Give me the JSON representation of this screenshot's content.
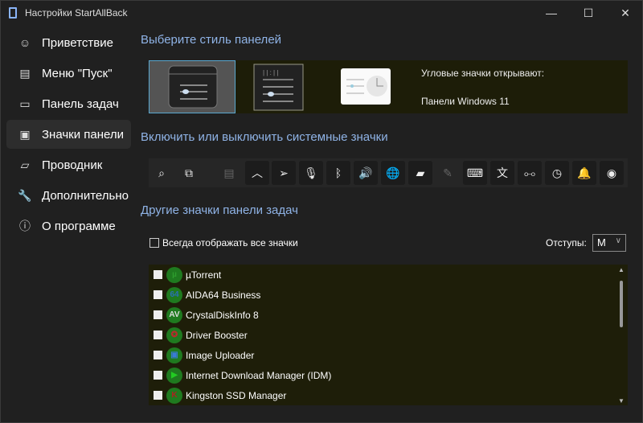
{
  "window": {
    "title": "Настройки StartAllBack",
    "minimize": "—",
    "maximize": "☐",
    "close": "✕"
  },
  "sidebar": {
    "items": [
      {
        "label": "Приветствие",
        "icon": "smiley-icon",
        "glyph": "☺"
      },
      {
        "label": "Меню \"Пуск\"",
        "icon": "start-menu-icon",
        "glyph": "▤"
      },
      {
        "label": "Панель задач",
        "icon": "taskbar-icon",
        "glyph": "▭"
      },
      {
        "label": "Значки панели",
        "icon": "tray-icons-icon",
        "glyph": "▣",
        "selected": true
      },
      {
        "label": "Проводник",
        "icon": "folder-icon",
        "glyph": "▱"
      },
      {
        "label": "Дополнительно",
        "icon": "wrench-icon",
        "glyph": "🔧"
      },
      {
        "label": "О программе",
        "icon": "info-icon",
        "glyph": "ⓘ"
      }
    ]
  },
  "style_section": {
    "heading": "Выберите стиль панелей",
    "corner_label": "Угловые значки открывают:",
    "corner_value": "Панели Windows 11",
    "selected_index": 0
  },
  "system_icons": {
    "heading": "Включить или выключить системные значки",
    "icons": [
      {
        "name": "search-icon",
        "glyph": "⌕"
      },
      {
        "name": "task-view-icon",
        "glyph": "⧉"
      },
      {
        "name": "widgets-icon",
        "glyph": "▤",
        "disabled": true
      },
      {
        "name": "chevron-up-icon",
        "glyph": "︿"
      },
      {
        "name": "location-icon",
        "glyph": "➢"
      },
      {
        "name": "microphone-icon",
        "glyph": "🎙"
      },
      {
        "name": "bluetooth-icon",
        "glyph": "ᛒ"
      },
      {
        "name": "volume-icon",
        "glyph": "🔊"
      },
      {
        "name": "network-icon",
        "glyph": "🌐"
      },
      {
        "name": "battery-icon",
        "glyph": "▰"
      },
      {
        "name": "pen-icon",
        "glyph": "✎",
        "disabled": true
      },
      {
        "name": "keyboard-icon",
        "glyph": "⌨"
      },
      {
        "name": "language-icon",
        "glyph": "文"
      },
      {
        "name": "mixer-icon",
        "glyph": "⧟"
      },
      {
        "name": "clock-icon",
        "glyph": "◷"
      },
      {
        "name": "bell-icon",
        "glyph": "🔔"
      },
      {
        "name": "eye-icon",
        "glyph": "◉"
      }
    ]
  },
  "other_icons": {
    "heading": "Другие значки панели задач",
    "always_show": "Всегда отображать все значки",
    "padding_label": "Отступы:",
    "padding_value": "M",
    "apps": [
      {
        "name": "µTorrent",
        "glyph": "µ",
        "color": "#2e9d2e"
      },
      {
        "name": "AIDA64 Business",
        "glyph": "64",
        "color": "#2a6fb5"
      },
      {
        "name": "CrystalDiskInfo 8",
        "glyph": "AV",
        "color": "#dddddd"
      },
      {
        "name": "Driver Booster",
        "glyph": "✪",
        "color": "#c0262d"
      },
      {
        "name": "Image Uploader",
        "glyph": "▣",
        "color": "#3a7bd5"
      },
      {
        "name": "Internet Download Manager (IDM)",
        "glyph": "▶",
        "color": "#22cc22"
      },
      {
        "name": "Kingston SSD Manager",
        "glyph": "K",
        "color": "#b02020"
      }
    ]
  }
}
